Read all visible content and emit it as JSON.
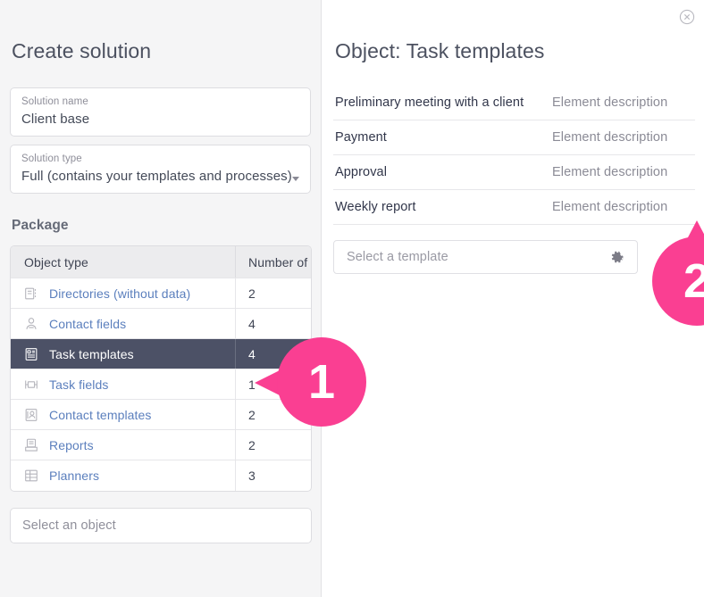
{
  "left": {
    "title": "Create solution",
    "fields": [
      {
        "label": "Solution name",
        "value": "Client base",
        "has_caret": false
      },
      {
        "label": "Solution type",
        "value": "Full (contains your templates and processes)",
        "has_caret": true
      }
    ],
    "package_heading": "Package",
    "table": {
      "columns": [
        "Object type",
        "Number of"
      ],
      "rows": [
        {
          "icon": "directory-icon",
          "label": "Directories (without data)",
          "count": "2",
          "selected": false
        },
        {
          "icon": "contact-field-icon",
          "label": "Contact fields",
          "count": "4",
          "selected": false
        },
        {
          "icon": "task-template-icon",
          "label": "Task templates",
          "count": "4",
          "selected": true
        },
        {
          "icon": "task-field-icon",
          "label": "Task fields",
          "count": "1",
          "selected": false
        },
        {
          "icon": "contact-template-icon",
          "label": "Contact templates",
          "count": "2",
          "selected": false
        },
        {
          "icon": "report-icon",
          "label": "Reports",
          "count": "2",
          "selected": false
        },
        {
          "icon": "planner-icon",
          "label": "Planners",
          "count": "3",
          "selected": false
        }
      ]
    },
    "select_object_placeholder": "Select an object"
  },
  "right": {
    "title": "Object: Task templates",
    "close_icon": "close-circle-icon",
    "elements": [
      {
        "name": "Preliminary meeting with a client",
        "description": "Element description"
      },
      {
        "name": "Payment",
        "description": "Element description"
      },
      {
        "name": "Approval",
        "description": "Element description"
      },
      {
        "name": "Weekly report",
        "description": "Element description"
      }
    ],
    "template_input": {
      "placeholder": "Select a template",
      "gear_icon": "gear-icon"
    }
  },
  "markers": [
    {
      "number": "1",
      "color": "#fa3f92",
      "points_to": "task-templates-row-count"
    },
    {
      "number": "2",
      "color": "#fa3f92",
      "points_to": "template-select-input"
    }
  ],
  "colors": {
    "accent_pink": "#fa3f92",
    "selected_row_bg": "#4c5166",
    "link_blue": "#5b7fbd",
    "panel_bg": "#f5f5f6"
  }
}
